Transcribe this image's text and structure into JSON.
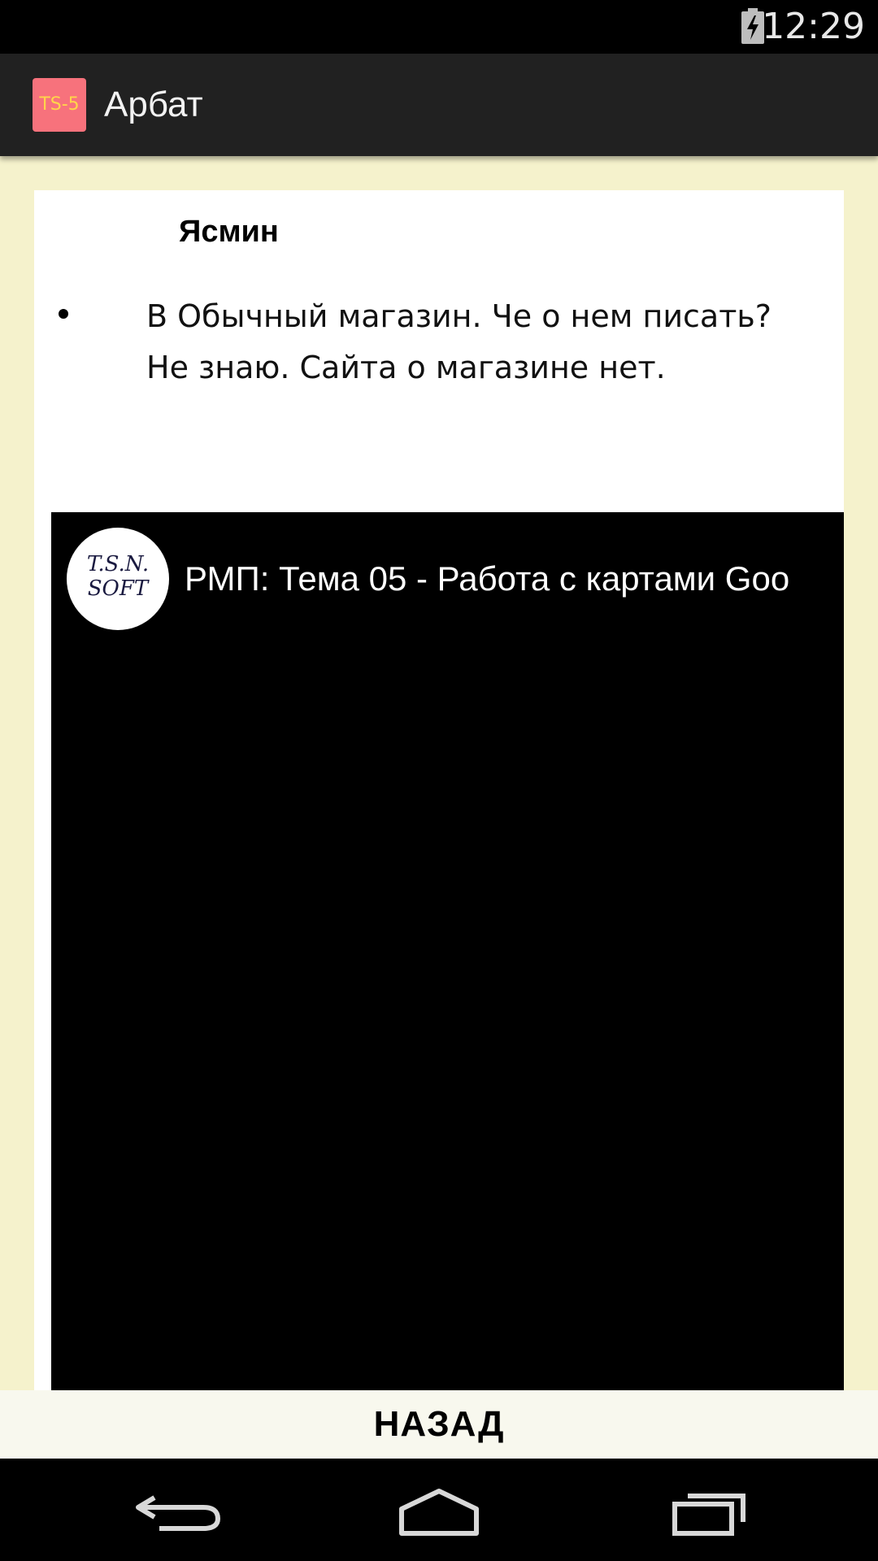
{
  "status_bar": {
    "time": "12:29",
    "battery_icon": "battery-charging-icon"
  },
  "action_bar": {
    "app_icon_text": "TS-5",
    "title": "Арбат"
  },
  "content": {
    "store_name": "Ясмин",
    "description": "В Обычный магазин. Че о нем писать? Не знаю. Сайта о магазине нет.",
    "video": {
      "channel_avatar_line1": "T.S.N.",
      "channel_avatar_line2": "SOFT",
      "title": "РМП: Тема 05 - Работа с картами Goo"
    }
  },
  "back_button": {
    "label": "НАЗАД"
  },
  "nav_bar": {
    "back": "back-arrow-icon",
    "home": "home-icon",
    "recents": "recent-apps-icon"
  },
  "colors": {
    "content_background": "#f5f2cc",
    "action_bar": "#212121",
    "app_icon": "#f7727c"
  }
}
